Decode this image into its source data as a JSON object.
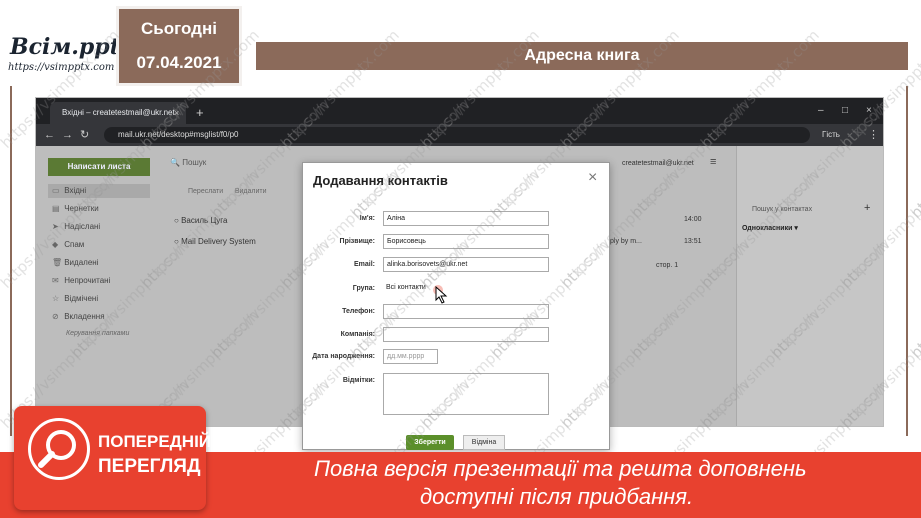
{
  "header": {
    "logo_title": "Всім.pptx",
    "logo_url": "https://vsimpptx.com",
    "today_label": "Сьогодні",
    "date": "07.04.2021",
    "slide_title": "Адресна книга"
  },
  "browser": {
    "tab_title": "Вхідні – createtestmail@ukr.net",
    "tab_close": "×",
    "new_tab": "+",
    "url": "mail.ukr.net/desktop#msglist/f0/p0",
    "guest_label": "Гість",
    "window_controls": [
      "–",
      "□",
      "×"
    ]
  },
  "mail": {
    "compose_label": "Написати листа",
    "folders": [
      {
        "icon": "inbox-icon",
        "glyph": "▭",
        "label": "Вхідні"
      },
      {
        "icon": "draft-icon",
        "glyph": "▤",
        "label": "Чернетки"
      },
      {
        "icon": "sent-icon",
        "glyph": "➤",
        "label": "Надіслані"
      },
      {
        "icon": "spam-icon",
        "glyph": "◆",
        "label": "Спам"
      },
      {
        "icon": "trash-icon",
        "glyph": "🗑",
        "label": "Видалені"
      },
      {
        "icon": "unread-icon",
        "glyph": "✉",
        "label": "Непрочитані"
      },
      {
        "icon": "star-icon",
        "glyph": "☆",
        "label": "Відмічені"
      },
      {
        "icon": "attach-icon",
        "glyph": "⊘",
        "label": "Вкладення"
      }
    ],
    "manage_folders": "Керування папками",
    "search_placeholder": "Пошук",
    "list_header_forward": "Переслати",
    "list_header_delete": "Видалити",
    "messages": [
      {
        "sender": "Василь Цуга",
        "time": "14:00"
      },
      {
        "sender": "Mail Delivery System",
        "snippet": "ply by m...",
        "time": "13:51"
      }
    ],
    "account_email": "createtestmail@ukr.net",
    "page_label": "стор. 1",
    "contacts_search": "Пошук у контактах",
    "contacts_group": "Однокласники ▾"
  },
  "modal": {
    "title": "Додавання контактів",
    "close": "×",
    "fields": {
      "name_label": "Ім'я:",
      "name_value": "Аліна",
      "surname_label": "Прізвище:",
      "surname_value": "Борисовець",
      "email_label": "Email:",
      "email_value": "alinka.borisovets@ukr.net",
      "group_label": "Група:",
      "group_value": "Всі контакти",
      "phone_label": "Телефон:",
      "company_label": "Компанія:",
      "birth_label": "Дата народження:",
      "birth_placeholder": "дд.мм.рррр",
      "notes_label": "Відмітки:"
    },
    "save_label": "Зберегти",
    "cancel_label": "Відміна"
  },
  "banner": {
    "preview_line1": "ПОПЕРЕДНІЙ",
    "preview_line2": "ПЕРЕГЛЯД",
    "text_line1": "Повна версія презентації та решта доповнень",
    "text_line2": "доступні після придбання."
  },
  "watermark": "https://vsimpptx.com",
  "colors": {
    "brown": "#8b6a5a",
    "red": "#e8412f",
    "green": "#5b8f2a"
  }
}
